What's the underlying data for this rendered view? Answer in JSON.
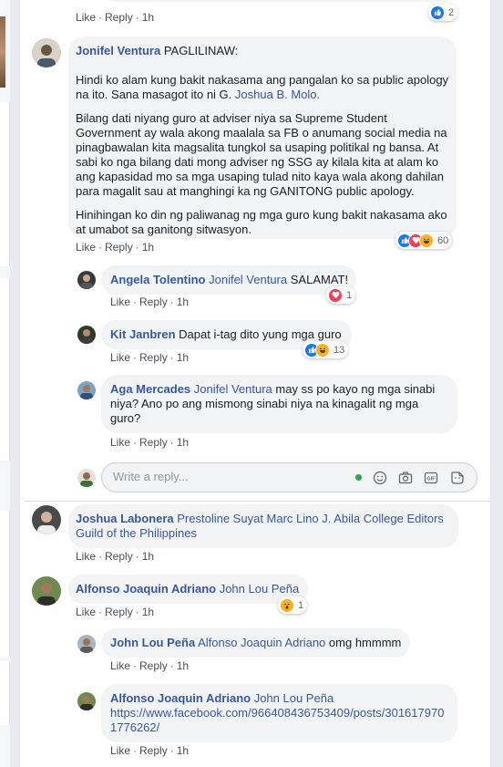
{
  "comments": [
    {
      "id": "top",
      "meta": {
        "like": "Like",
        "reply": "Reply",
        "time": "1h"
      },
      "reaction_count": "2"
    },
    {
      "id": "jonifel",
      "author": "Jonifel Ventura",
      "heading": "PAGLILINAW:",
      "p1_text": "Hindi ko alam kung bakit nakasama ang pangalan ko sa public apology na ito. Sana masagot ito ni G.",
      "p1_mention": "Joshua B. Molo.",
      "p2": "Bilang dati niyang guro at adviser niya sa Supreme Student Government ay wala akong maalala sa FB o anumang social media na pinagbawalan kita magsalita tungkol sa usaping politikal ng bansa. At sabi ko nga bilang dati mong adviser ng SSG ay kilala kita at alam ko ang kapasidad mo sa mga usaping tulad nito kaya wala akong dahilan para magalit sau at manghingi ka ng GANITONG public apology.",
      "p3": "Hinihingan ko din ng paliwanag ng mga guro kung bakit nakasama ako at umabot sa ganitong sitwasyon.",
      "meta": {
        "like": "Like",
        "reply": "Reply",
        "time": "1h"
      },
      "reaction_count": "60"
    },
    {
      "id": "angela",
      "author": "Angela Tolentino",
      "mention": "Jonifel Ventura",
      "text": "SALAMAT!",
      "meta": {
        "like": "Like",
        "reply": "Reply",
        "time": "1h"
      },
      "reaction_count": "1"
    },
    {
      "id": "kit",
      "author": "Kit Janbren",
      "text": "Dapat i-tag dito yung mga guro",
      "meta": {
        "like": "Like",
        "reply": "Reply",
        "time": "1h"
      },
      "reaction_count": "13"
    },
    {
      "id": "aga",
      "author": "Aga Mercades",
      "mention": "Jonifel Ventura",
      "text": "may ss po kayo ng mga sinabi niya? Ano po ang mismong sinabi niya na kinagalit ng mga guro?",
      "meta": {
        "like": "Like",
        "reply": "Reply",
        "time": "1h"
      }
    },
    {
      "id": "joshua",
      "author": "Joshua Labonera",
      "mention": "Prestoline Suyat Marc Lino J. Abila College Editors Guild of the Philippines",
      "meta": {
        "like": "Like",
        "reply": "Reply",
        "time": "1h"
      }
    },
    {
      "id": "alfonso",
      "author": "Alfonso Joaquin Adriano",
      "mention": "John Lou Peña",
      "meta": {
        "like": "Like",
        "reply": "Reply",
        "time": "1h"
      },
      "reaction_count": "1"
    },
    {
      "id": "johnlou",
      "author": "John Lou Peña",
      "mention": "Alfonso Joaquin Adriano",
      "text": "omg hmmmm",
      "meta": {
        "like": "Like",
        "reply": "Reply",
        "time": "1h"
      }
    },
    {
      "id": "alfonso2",
      "author": "Alfonso Joaquin Adriano",
      "mention": "John Lou Peña",
      "link": "https://www.facebook.com/966408436753409/posts/3016179701776262/",
      "meta": {
        "like": "Like",
        "reply": "Reply",
        "time": "1h"
      }
    }
  ],
  "reply_box": {
    "placeholder": "Write a reply..."
  },
  "icons": {
    "like": "like-reaction-icon",
    "love": "love-reaction-icon",
    "haha": "haha-reaction-icon",
    "wow": "wow-reaction-icon",
    "emoji": "emoji-icon",
    "camera": "camera-icon",
    "gif": "gif-icon",
    "sticker": "sticker-icon"
  },
  "colors": {
    "link": "#385898",
    "bubble": "#f2f3f5",
    "like_blue": "#1877f2",
    "love_red": "#f33e58",
    "haha_yellow": "#f7b125",
    "online_green": "#31a24c"
  }
}
